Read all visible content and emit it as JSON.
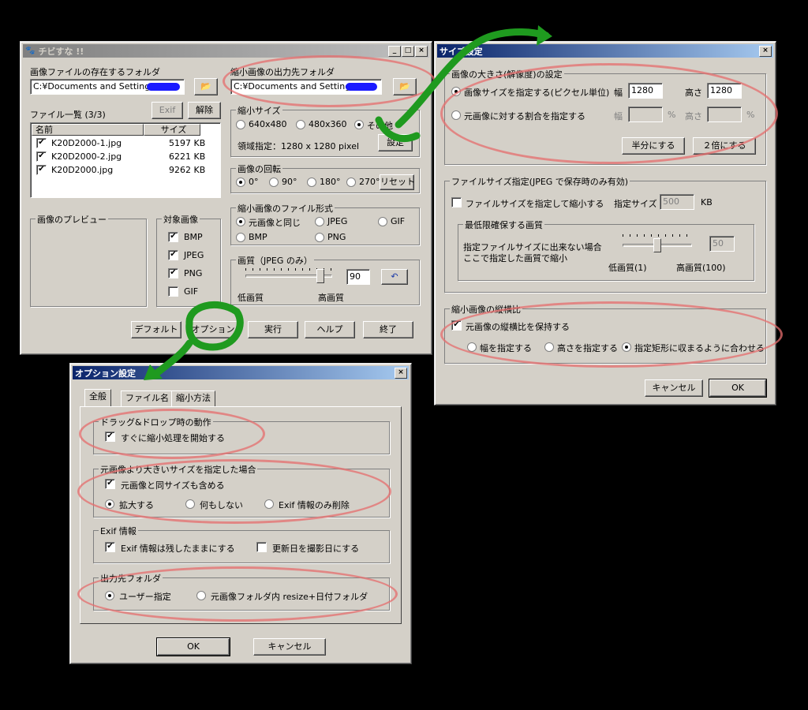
{
  "main": {
    "title": "チビすな !!",
    "src_folder_label": "画像ファイルの存在するフォルダ",
    "src_folder_value": "C:¥Documents and Settings¥",
    "dst_folder_label": "縮小画像の出力先フォルダ",
    "dst_folder_value": "C:¥Documents and Settings¥",
    "file_list_label": "ファイル一覧 (3/3)",
    "exif_btn": "Exif",
    "release_btn": "解除",
    "columns": [
      "名前",
      "サイズ"
    ],
    "files": [
      {
        "name": "K20D2000-1.jpg",
        "size": "5197 KB"
      },
      {
        "name": "K20D2000-2.jpg",
        "size": "6221 KB"
      },
      {
        "name": "K20D2000.jpg",
        "size": "9262 KB"
      }
    ],
    "reduce_size_group": "縮小サイズ",
    "size_opts": [
      "640x480",
      "480x360",
      "その他"
    ],
    "area_spec": "領域指定：1280 x 1280 pixel",
    "settings_btn": "設定",
    "rotate_group": "画像の回転",
    "rotate_opts": [
      "0°",
      "90°",
      "180°",
      "270°"
    ],
    "reset_btn": "リセット",
    "format_group": "縮小画像のファイル形式",
    "format_opts": [
      "元画像と同じ",
      "JPEG",
      "GIF",
      "BMP",
      "PNG"
    ],
    "quality_group": "画質（JPEG のみ）",
    "quality_value": "90",
    "quality_fraction": 0.9,
    "quality_low": "低画質",
    "quality_high": "高画質",
    "preview_group": "画像のプレビュー",
    "target_group": "対象画像",
    "targets": [
      "BMP",
      "JPEG",
      "PNG",
      "GIF"
    ],
    "buttons": [
      "デフォルト",
      "オプション",
      "実行",
      "ヘルプ",
      "終了"
    ]
  },
  "size_dialog": {
    "title": "サイズ設定",
    "size_group": "画像の大きさ(解像度)の設定",
    "pixel_opt": "画像サイズを指定する(ピクセル単位)",
    "width_label": "幅",
    "height_label": "高さ",
    "width_value": "1280",
    "height_value": "1280",
    "ratio_opt": "元画像に対する割合を指定する",
    "percent": "%",
    "half_btn": "半分にする",
    "double_btn": "２倍にする",
    "filesize_group": "ファイルサイズ指定(JPEG で保存時のみ有効)",
    "filesize_chk": "ファイルサイズを指定して縮小する",
    "target_size_label": "指定サイズ",
    "target_size_value": "500",
    "kb": "KB",
    "min_quality_group": "最低限確保する画質",
    "min_quality_line1": "指定ファイルサイズに出来ない場合",
    "min_quality_line2": "ここで指定した画質で縮小",
    "min_quality_value": "50",
    "min_quality_fraction": 0.5,
    "low": "低画質(1)",
    "high": "高画質(100)",
    "aspect_group": "縮小画像の縦横比",
    "keep_aspect": "元画像の縦横比を保持する",
    "aspect_opts": [
      "幅を指定する",
      "高さを指定する",
      "指定矩形に収まるように合わせる"
    ],
    "cancel_btn": "キャンセル",
    "ok_btn": "OK"
  },
  "options_dialog": {
    "title": "オプション設定",
    "tabs": [
      "全般",
      "ファイル名",
      "縮小方法"
    ],
    "dd_group": "ドラッグ&ドロップ時の動作",
    "dd_chk": "すぐに縮小処理を開始する",
    "larger_group": "元画像より大きいサイズを指定した場合",
    "larger_chk": "元画像と同サイズも含める",
    "larger_opts": [
      "拡大する",
      "何もしない",
      "Exif 情報のみ削除"
    ],
    "exif_group": "Exif 情報",
    "exif_keep": "Exif 情報は残したままにする",
    "exif_date": "更新日を撮影日にする",
    "out_group": "出力先フォルダ",
    "out_opts": [
      "ユーザー指定",
      "元画像フォルダ内 resize+日付フォルダ"
    ],
    "ok_btn": "OK",
    "cancel_btn": "キャンセル"
  },
  "colors": {
    "annotation_red": "#e66e6e",
    "annotation_green": "#1f9a1f"
  }
}
